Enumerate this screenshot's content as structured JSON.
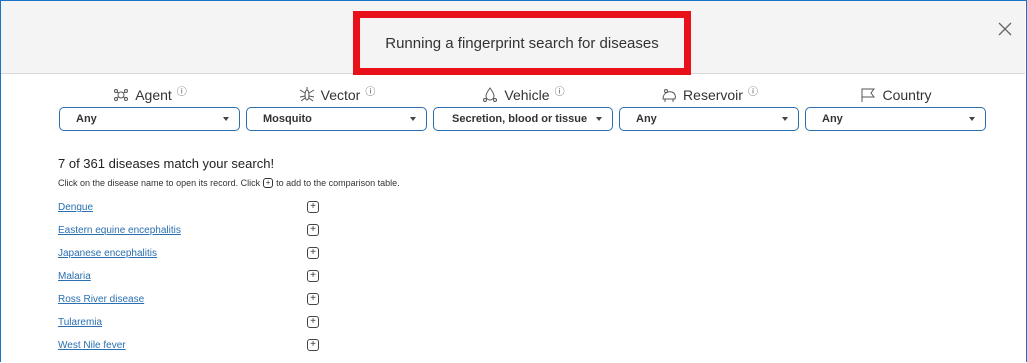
{
  "header": {
    "title": "Running a fingerprint search for diseases",
    "close_icon": "close-icon"
  },
  "filters": [
    {
      "label": "Agent",
      "icon": "agent-icon",
      "help_icon": "help-icon",
      "value": "Any"
    },
    {
      "label": "Vector",
      "icon": "vector-icon",
      "help_icon": "help-icon",
      "value": "Mosquito"
    },
    {
      "label": "Vehicle",
      "icon": "vehicle-icon",
      "help_icon": "help-icon",
      "value": "Secretion, blood or tissue"
    },
    {
      "label": "Reservoir",
      "icon": "reservoir-icon",
      "help_icon": "help-icon",
      "value": "Any"
    },
    {
      "label": "Country",
      "icon": "flag-icon",
      "value": "Any"
    }
  ],
  "results": {
    "summary": "7 of 361 diseases match your search!",
    "hint_before": "Click on the disease name to open its record. Click",
    "hint_after": "to add to the comparison table.",
    "diseases": [
      "Dengue",
      "Eastern equine encephalitis",
      "Japanese encephalitis",
      "Malaria",
      "Ross River disease",
      "Tularemia",
      "West Nile fever"
    ]
  },
  "colors": {
    "accent": "#2a6fb0",
    "highlight_border": "#e8111a",
    "header_bg": "#f4f4f4"
  }
}
